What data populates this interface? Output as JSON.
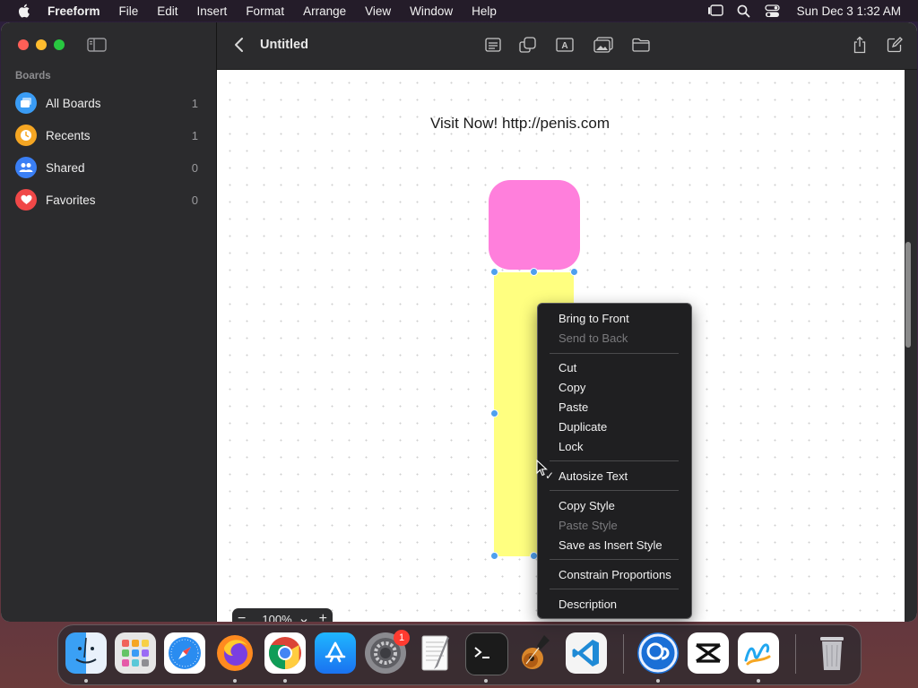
{
  "menubar": {
    "app_name": "Freeform",
    "items": [
      "File",
      "Edit",
      "Insert",
      "Format",
      "Arrange",
      "View",
      "Window",
      "Help"
    ],
    "clock": "Sun Dec 3  1:32 AM",
    "status_icons": [
      "stage-manager-icon",
      "spotlight-search-icon",
      "control-center-icon"
    ]
  },
  "sidebar": {
    "heading": "Boards",
    "items": [
      {
        "label": "All Boards",
        "count": "1",
        "icon": "all-boards-icon",
        "color": "#3a9cf5"
      },
      {
        "label": "Recents",
        "count": "1",
        "icon": "clock-icon",
        "color": "#f5a623"
      },
      {
        "label": "Shared",
        "count": "0",
        "icon": "people-icon",
        "color": "#3a7ff5"
      },
      {
        "label": "Favorites",
        "count": "0",
        "icon": "heart-icon",
        "color": "#f04848"
      }
    ]
  },
  "toolbar": {
    "title": "Untitled",
    "tools": [
      "sticky-note-icon",
      "shapes-icon",
      "text-box-icon",
      "media-icon",
      "file-icon"
    ],
    "actions": [
      "share-icon",
      "new-board-icon"
    ]
  },
  "canvas": {
    "text_box": "Visit Now! http://penis.com",
    "shapes": [
      {
        "name": "rounded-square",
        "color": "#ff7fdc"
      },
      {
        "name": "rectangle",
        "color": "#ffff80"
      }
    ],
    "zoom": {
      "value": "100%",
      "minus": "−",
      "plus": "+"
    }
  },
  "context_menu": {
    "items": [
      {
        "label": "Bring to Front",
        "enabled": true
      },
      {
        "label": "Send to Back",
        "enabled": false
      },
      {
        "label": "Cut",
        "enabled": true
      },
      {
        "label": "Copy",
        "enabled": true
      },
      {
        "label": "Paste",
        "enabled": true
      },
      {
        "label": "Duplicate",
        "enabled": true
      },
      {
        "label": "Lock",
        "enabled": true
      },
      {
        "label": "Autosize Text",
        "enabled": true,
        "checked": true
      },
      {
        "label": "Copy Style",
        "enabled": true
      },
      {
        "label": "Paste Style",
        "enabled": false
      },
      {
        "label": "Save as Insert Style",
        "enabled": true
      },
      {
        "label": "Constrain Proportions",
        "enabled": true
      },
      {
        "label": "Description",
        "enabled": true
      }
    ],
    "check_mark": "✓"
  },
  "dock": {
    "apps": [
      "Finder",
      "Launchpad",
      "Safari",
      "Firefox",
      "Chrome",
      "App Store",
      "System Settings",
      "TextEdit",
      "Terminal",
      "GarageBand",
      "Visual Studio Code",
      "Screen Sharing",
      "CapCut",
      "Freeform",
      "Trash"
    ],
    "settings_badge": "1"
  }
}
